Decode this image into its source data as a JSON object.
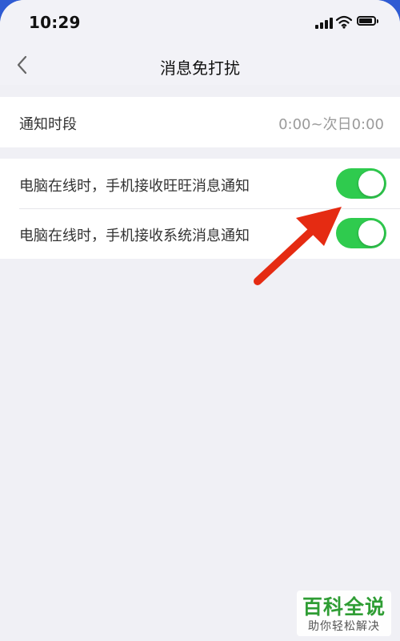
{
  "status_bar": {
    "time": "10:29",
    "signal_icon": "signal-icon",
    "wifi_icon": "wifi-icon",
    "battery_icon": "battery-icon"
  },
  "nav": {
    "back_icon": "back-chevron-icon",
    "title": "消息免打扰"
  },
  "settings": {
    "notify_period_label": "通知时段",
    "notify_period_value": "0:00~次日0:00",
    "items": [
      {
        "label": "电脑在线时，手机接收旺旺消息通知",
        "enabled": true
      },
      {
        "label": "电脑在线时，手机接收系统消息通知",
        "enabled": true
      }
    ]
  },
  "colors": {
    "toggle_on": "#2fcb4e",
    "annotation_arrow": "#e52b12",
    "watermark_green": "#2f9d34"
  },
  "watermark": {
    "main": "百科全说",
    "sub": "助你轻松解决"
  }
}
